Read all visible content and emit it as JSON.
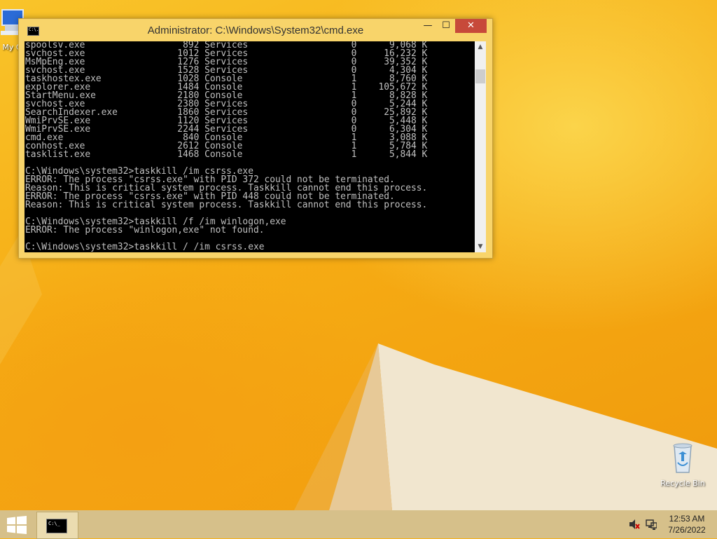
{
  "desktop": {
    "icons": [
      {
        "label": "My C",
        "icon": "computer-icon"
      },
      {
        "label": "Recycle Bin",
        "icon": "recycle-bin-icon"
      }
    ]
  },
  "cmd_window": {
    "title": "Administrator: C:\\Windows\\System32\\cmd.exe",
    "app_icon_text": "C:\\.",
    "buttons": {
      "minimize": "—",
      "maximize": "☐",
      "close": "✕"
    },
    "console_lines": [
      "spoolsv.exe                  892 Services                   0      9,068 K",
      "svchost.exe                 1012 Services                   0     16,232 K",
      "MsMpEng.exe                 1276 Services                   0     39,352 K",
      "svchost.exe                 1528 Services                   0      4,304 K",
      "taskhostex.exe              1028 Console                    1      8,760 K",
      "explorer.exe                1484 Console                    1    105,672 K",
      "StartMenu.exe               2180 Console                    1      8,828 K",
      "svchost.exe                 2380 Services                   0      5,244 K",
      "SearchIndexer.exe           1860 Services                   0     25,892 K",
      "WmiPrvSE.exe                1120 Services                   0      5,448 K",
      "WmiPrvSE.exe                2244 Services                   0      6,304 K",
      "cmd.exe                      840 Console                    1      3,088 K",
      "conhost.exe                 2612 Console                    1      5,784 K",
      "tasklist.exe                1468 Console                    1      5,844 K",
      "",
      "C:\\Windows\\system32>taskkill /im csrss.exe",
      "ERROR: The process \"csrss.exe\" with PID 372 could not be terminated.",
      "Reason: This is critical system process. Taskkill cannot end this process.",
      "ERROR: The process \"csrss.exe\" with PID 448 could not be terminated.",
      "Reason: This is critical system process. Taskkill cannot end this process.",
      "",
      "C:\\Windows\\system32>taskkill /f /im winlogon,exe",
      "ERROR: The process \"winlogon,exe\" not found.",
      "",
      "C:\\Windows\\system32>taskkill / /im csrss.exe"
    ]
  },
  "taskbar": {
    "task_icon_text": "C:\\_",
    "clock_time": "12:53 AM",
    "clock_date": "7/26/2022",
    "tray": [
      "speaker-muted-icon",
      "network-error-icon"
    ]
  },
  "colors": {
    "wallpaper": "#f7b21a",
    "window_frame": "#f8d46a",
    "close_button": "#c7493a",
    "console_bg": "#000000",
    "console_text": "#c0c0c0",
    "taskbar": "#d6c08a"
  }
}
